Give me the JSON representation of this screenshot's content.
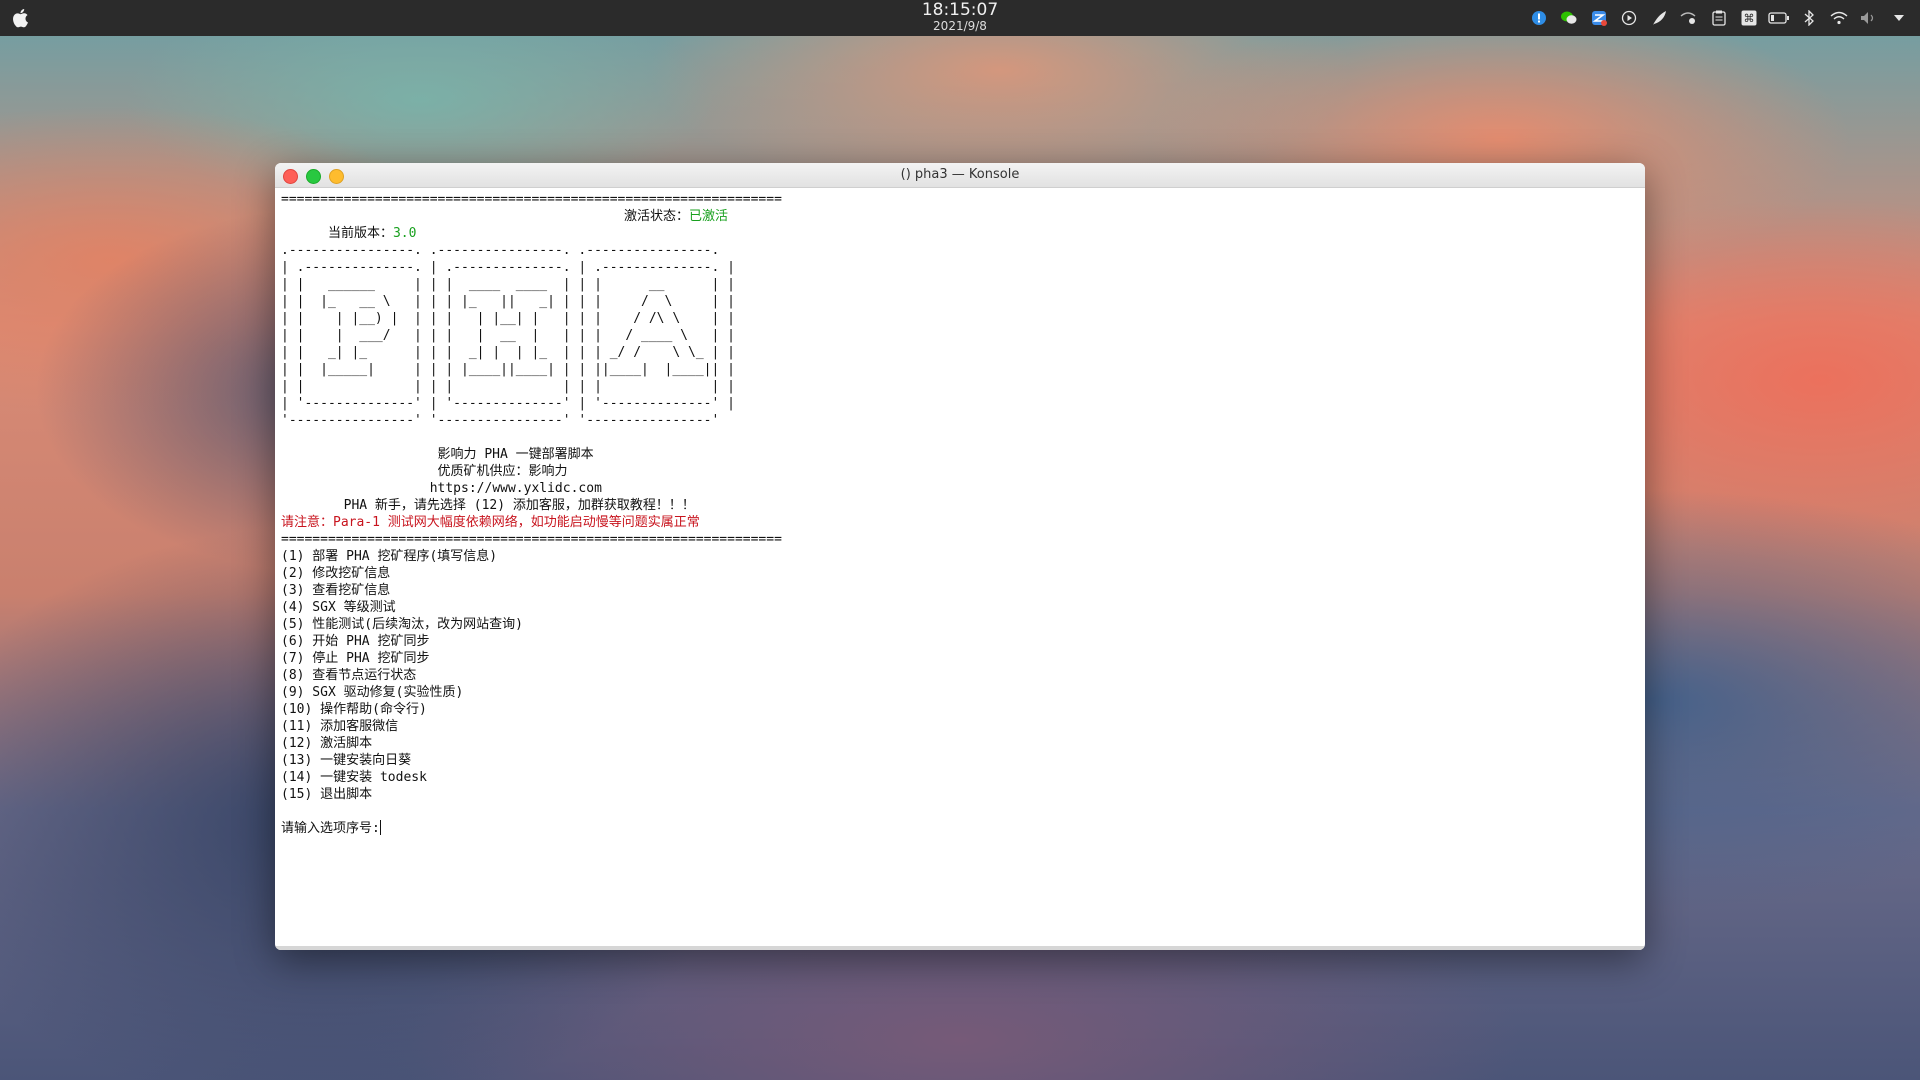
{
  "topbar": {
    "time": "18:15:07",
    "date": "2021/9/8",
    "tray_icons": [
      "info-icon",
      "wechat-icon",
      "ime-icon",
      "media-play-icon",
      "feather-icon",
      "user-network-icon",
      "clipboard-icon",
      "command-icon",
      "battery-icon",
      "bluetooth-icon",
      "wifi-icon",
      "volume-muted-icon",
      "chevron-down-icon"
    ]
  },
  "window": {
    "title": "() pha3 — Konsole"
  },
  "terminal": {
    "separator": "================================================================",
    "version_label": "当前版本：",
    "version_value": "3.0",
    "activation_label": "激活状态：",
    "activation_value": "已激活",
    "ascii_art": [
      ".----------------. .----------------. .----------------.",
      "| .--------------. | .--------------. | .--------------. |",
      "| |   ______     | | |  ____  ____  | | |      __      | |",
      "| |  |_   __ \\   | | | |_   ||   _| | | |     /  \\     | |",
      "| |    | |__) |  | | |   | |__| |   | | |    / /\\ \\    | |",
      "| |    |  ___/   | | |   |  __  |   | | |   / ____ \\   | |",
      "| |   _| |_      | | |  _| |  | |_  | | | _/ /    \\ \\_ | |",
      "| |  |_____|     | | | |____||____| | | ||____|  |____|| |",
      "| |              | | |              | | |              | |",
      "| '--------------' | '--------------' | '--------------' |",
      "'----------------' '----------------' '----------------'"
    ],
    "intro_lines": [
      "                    影响力 PHA 一键部署脚本",
      "                    优质矿机供应：影响力",
      "                   https://www.yxlidc.com",
      "        PHA 新手，请先选择 (12) 添加客服，加群获取教程！！！"
    ],
    "warning": "请注意：Para-1 测试网大幅度依赖网络，如功能启动慢等问题实属正常",
    "menu": [
      "(1) 部署 PHA 挖矿程序(填写信息)",
      "(2) 修改挖矿信息",
      "(3) 查看挖矿信息",
      "(4) SGX 等级测试",
      "(5) 性能测试(后续淘汰，改为网站查询)",
      "(6) 开始 PHA 挖矿同步",
      "(7) 停止 PHA 挖矿同步",
      "(8) 查看节点运行状态",
      "(9) SGX 驱动修复(实验性质)",
      "(10) 操作帮助(命令行)",
      "(11) 添加客服微信",
      "(12) 激活脚本",
      "(13) 一键安装向日葵",
      "(14) 一键安装 todesk",
      "(15) 退出脚本"
    ],
    "prompt": "请输入选项序号:"
  }
}
